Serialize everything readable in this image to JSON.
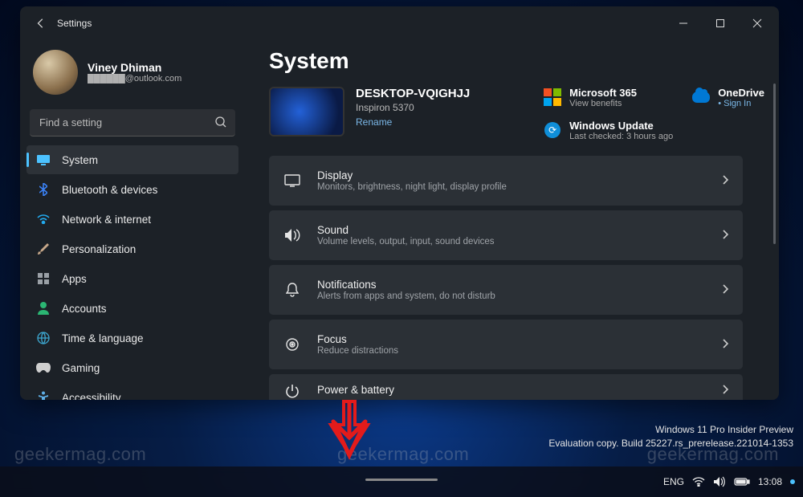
{
  "titlebar": {
    "title": "Settings"
  },
  "profile": {
    "name": "Viney Dhiman",
    "email": "██████@outlook.com"
  },
  "search": {
    "placeholder": "Find a setting"
  },
  "nav": [
    {
      "id": "system",
      "label": "System",
      "icon": "display-icon",
      "color": "#4cc2ff",
      "active": true
    },
    {
      "id": "bluetooth",
      "label": "Bluetooth & devices",
      "icon": "bluetooth-icon",
      "color": "#3b82f6"
    },
    {
      "id": "network",
      "label": "Network & internet",
      "icon": "wifi-icon",
      "color": "#22aaee"
    },
    {
      "id": "personalization",
      "label": "Personalization",
      "icon": "brush-icon",
      "color": "#c7a88a"
    },
    {
      "id": "apps",
      "label": "Apps",
      "icon": "apps-icon",
      "color": "#9aa0a6"
    },
    {
      "id": "accounts",
      "label": "Accounts",
      "icon": "person-icon",
      "color": "#2bb673"
    },
    {
      "id": "time",
      "label": "Time & language",
      "icon": "globe-icon",
      "color": "#3da8d1"
    },
    {
      "id": "gaming",
      "label": "Gaming",
      "icon": "gamepad-icon",
      "color": "#cfcfcf"
    },
    {
      "id": "accessibility",
      "label": "Accessibility",
      "icon": "accessibility-icon",
      "color": "#5fb0e8"
    }
  ],
  "page": {
    "title": "System"
  },
  "device": {
    "name": "DESKTOP-VQIGHJJ",
    "model": "Inspiron 5370",
    "rename": "Rename"
  },
  "quick": {
    "ms365": {
      "title": "Microsoft 365",
      "sub": "View benefits"
    },
    "onedrive": {
      "title": "OneDrive",
      "link": "Sign In"
    },
    "update": {
      "title": "Windows Update",
      "sub": "Last checked: 3 hours ago"
    }
  },
  "settings": [
    {
      "id": "display",
      "title": "Display",
      "sub": "Monitors, brightness, night light, display profile",
      "icon": "monitor-icon"
    },
    {
      "id": "sound",
      "title": "Sound",
      "sub": "Volume levels, output, input, sound devices",
      "icon": "speaker-icon"
    },
    {
      "id": "notifications",
      "title": "Notifications",
      "sub": "Alerts from apps and system, do not disturb",
      "icon": "bell-icon"
    },
    {
      "id": "focus",
      "title": "Focus",
      "sub": "Reduce distractions",
      "icon": "focus-icon"
    },
    {
      "id": "power",
      "title": "Power & battery",
      "sub": "",
      "icon": "power-icon"
    }
  ],
  "desktop": {
    "preview_line1": "Windows 11 Pro Insider Preview",
    "preview_line2": "Evaluation copy. Build 25227.rs_prerelease.221014-1353",
    "watermark": "geekermag.com",
    "lang": "ENG",
    "time": "13:08"
  }
}
